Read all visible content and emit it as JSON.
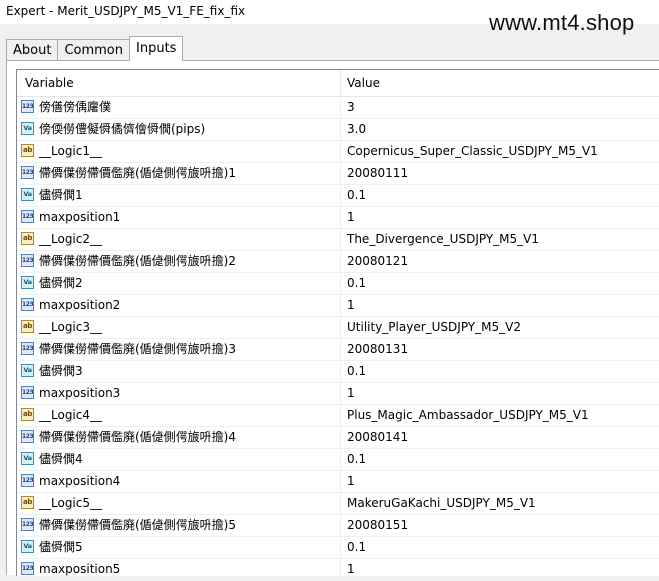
{
  "window": {
    "title": "Expert - Merit_USDJPY_M5_V1_FE_fix_fix"
  },
  "watermark": "www.mt4.shop",
  "tabs": [
    {
      "label": "About",
      "active": false
    },
    {
      "label": "Common",
      "active": false
    },
    {
      "label": "Inputs",
      "active": true
    }
  ],
  "grid": {
    "headers": {
      "variable": "Variable",
      "value": "Value"
    },
    "rows": [
      {
        "icon": "123",
        "type": "int-icon",
        "name": "傍僐傍偊廜僕",
        "value": "3"
      },
      {
        "icon": "Va",
        "type": "double-icon",
        "name": "傍偄僗僼儗僢僪儕儈僢僩(pips)",
        "value": "3.0"
      },
      {
        "icon": "ab",
        "type": "string-icon",
        "name": "__Logic1__",
        "value": "Copernicus_Super_Classic_USDJPY_M5_V1"
      },
      {
        "icon": "123",
        "type": "int-icon",
        "name": "僀僲僷僗僀價儖廃(偱偼側偔旇呏擔)1",
        "value": "20080111"
      },
      {
        "icon": "Va",
        "type": "double-icon",
        "name": "儘僢僩1",
        "value": "0.1"
      },
      {
        "icon": "123",
        "type": "int-icon",
        "name": "maxposition1",
        "value": "1"
      },
      {
        "icon": "ab",
        "type": "string-icon",
        "name": "__Logic2__",
        "value": "The_Divergence_USDJPY_M5_V1"
      },
      {
        "icon": "123",
        "type": "int-icon",
        "name": "僀僲僷僗僀價儖廃(偱偼側偔旇呏擔)2",
        "value": "20080121"
      },
      {
        "icon": "Va",
        "type": "double-icon",
        "name": "儘僢僩2",
        "value": "0.1"
      },
      {
        "icon": "123",
        "type": "int-icon",
        "name": "maxposition2",
        "value": "1"
      },
      {
        "icon": "ab",
        "type": "string-icon",
        "name": "__Logic3__",
        "value": "Utility_Player_USDJPY_M5_V2"
      },
      {
        "icon": "123",
        "type": "int-icon",
        "name": "僀僲僷僗僀價儖廃(偱偼側偔旇呏擔)3",
        "value": "20080131"
      },
      {
        "icon": "Va",
        "type": "double-icon",
        "name": "儘僢僩3",
        "value": "0.1"
      },
      {
        "icon": "123",
        "type": "int-icon",
        "name": "maxposition3",
        "value": "1"
      },
      {
        "icon": "ab",
        "type": "string-icon",
        "name": "__Logic4__",
        "value": "Plus_Magic_Ambassador_USDJPY_M5_V1"
      },
      {
        "icon": "123",
        "type": "int-icon",
        "name": "僀僲僷僗僀價儖廃(偱偼側偔旇呏擔)4",
        "value": "20080141"
      },
      {
        "icon": "Va",
        "type": "double-icon",
        "name": "儘僢僩4",
        "value": "0.1"
      },
      {
        "icon": "123",
        "type": "int-icon",
        "name": "maxposition4",
        "value": "1"
      },
      {
        "icon": "ab",
        "type": "string-icon",
        "name": "__Logic5__",
        "value": "MakeruGaKachi_USDJPY_M5_V1"
      },
      {
        "icon": "123",
        "type": "int-icon",
        "name": "僀僲僷僗僀價儖廃(偱偼側偔旇呏擔)5",
        "value": "20080151"
      },
      {
        "icon": "Va",
        "type": "double-icon",
        "name": "儘僢僩5",
        "value": "0.1"
      },
      {
        "icon": "123",
        "type": "int-icon",
        "name": "maxposition5",
        "value": "1"
      }
    ]
  }
}
